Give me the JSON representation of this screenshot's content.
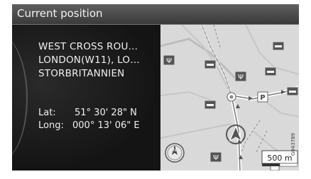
{
  "header": {
    "title": "Current position"
  },
  "address": {
    "line1": "WEST CROSS ROU…",
    "line2": "LONDON(W11), LO…",
    "line3": "STORBRITANNIEN"
  },
  "coordinates": {
    "lat_label": "Lat:",
    "lat_value": "51° 30' 28\" N",
    "long_label": "Long:",
    "long_value": "000° 13' 06\" E"
  },
  "map": {
    "scale_label": "500 m",
    "compass_icon": "compass-icon",
    "vehicle_icon": "vehicle-position-icon",
    "poi_icons": [
      "hotel-icon",
      "restaurant-icon",
      "parking-icon",
      "fuel-station-icon"
    ]
  },
  "figure_code": "G043789"
}
